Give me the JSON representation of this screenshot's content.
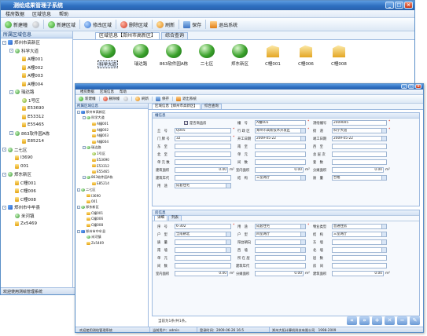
{
  "app": {
    "title": "测绘成果管理子系统"
  },
  "menu": [
    "楼房数据",
    "区域信息",
    "帮助"
  ],
  "toolbar1": [
    {
      "label": "新建幢",
      "icon": "i-green"
    },
    {
      "label": "新建区域",
      "icon": "i-green"
    },
    {
      "label": "修改区域",
      "icon": "i-blue"
    },
    {
      "label": "删除区域",
      "icon": "i-red"
    },
    {
      "label": "刷新",
      "icon": "i-orange"
    },
    {
      "label": "保存",
      "icon": "i-save"
    },
    {
      "label": "退出系统",
      "icon": "i-exit"
    }
  ],
  "toolbar2": [
    {
      "label": "新建幢",
      "icon": "i-green"
    },
    {
      "label": "删除幢",
      "icon": "i-red"
    },
    {
      "label": "刷新",
      "icon": "i-orange"
    },
    {
      "label": "保存",
      "icon": "i-save"
    },
    {
      "label": "退出系统",
      "icon": "i-exit"
    }
  ],
  "left_panel": {
    "title": "所属区域信息"
  },
  "tree": [
    {
      "label": "郑州市高新区",
      "level": 0,
      "icon": "net",
      "exp": "-"
    },
    {
      "label": "科学大道",
      "level": 1,
      "icon": "globe",
      "exp": "-"
    },
    {
      "label": "A幢001",
      "level": 2,
      "icon": "bld"
    },
    {
      "label": "A幢002",
      "level": 2,
      "icon": "bld"
    },
    {
      "label": "A幢003",
      "level": 2,
      "icon": "bld"
    },
    {
      "label": "A幢004",
      "level": 2,
      "icon": "bld"
    },
    {
      "label": "瑞达路",
      "level": 1,
      "icon": "globe",
      "exp": "-"
    },
    {
      "label": "1号区",
      "level": 2,
      "icon": "area"
    },
    {
      "label": "E53690",
      "level": 2,
      "icon": "bld"
    },
    {
      "label": "E53312",
      "level": 2,
      "icon": "bld"
    },
    {
      "label": "E55465",
      "level": 2,
      "icon": "bld"
    },
    {
      "label": "863软件园A栋",
      "level": 1,
      "icon": "globe",
      "exp": "-"
    },
    {
      "label": "E85214",
      "level": 2,
      "icon": "bld"
    },
    {
      "label": "二七区",
      "level": 0,
      "icon": "globe",
      "exp": "-"
    },
    {
      "label": "I3690",
      "level": 1,
      "icon": "bld"
    },
    {
      "label": "001",
      "level": 1,
      "icon": "bld"
    },
    {
      "label": "郑东新区",
      "level": 0,
      "icon": "globe",
      "exp": "-"
    },
    {
      "label": "C幢001",
      "level": 1,
      "icon": "bld"
    },
    {
      "label": "C幢006",
      "level": 1,
      "icon": "bld"
    },
    {
      "label": "C幢008",
      "level": 1,
      "icon": "bld"
    },
    {
      "label": "郑州市中牟县",
      "level": 0,
      "icon": "net",
      "exp": "-"
    },
    {
      "label": "米河镇",
      "level": 1,
      "icon": "globe"
    },
    {
      "label": "Zx5469",
      "level": 1,
      "icon": "bld"
    }
  ],
  "w1": {
    "tabs": [
      "区域信息【郑州市高新区】",
      "综合查询"
    ],
    "grid": [
      {
        "label": "科学大道",
        "icon": "globe",
        "selected": true
      },
      {
        "label": "瑞达路",
        "icon": "globe"
      },
      {
        "label": "863软件园A栋",
        "icon": "globe"
      },
      {
        "label": "二七区",
        "icon": "globe"
      },
      {
        "label": "郑东新区",
        "icon": "globe"
      },
      {
        "label": "C幢001",
        "icon": "bld"
      },
      {
        "label": "C幢006",
        "icon": "bld"
      },
      {
        "label": "C幢008",
        "icon": "bld"
      }
    ],
    "status": "欢迎使用测绘管理系统"
  },
  "w2": {
    "tabs": [
      "区域信息【郑州市高新区】",
      "综合查询"
    ],
    "building_group": "幢信息",
    "house_group": "房信息",
    "house_tabs": [
      "详细",
      "列表"
    ],
    "pager": "当前为1条/共1条。",
    "status": {
      "welcome": "欢迎使用测绘管理系统",
      "user": "当前用户：admin",
      "login": "登录时间：2009-06-26 16:5",
      "copyright": "郑州大阳计算机科技有限公司　1998-2009"
    }
  },
  "bform": {
    "l_best": "是否商品房",
    "v_best": "✓",
    "l_zh": "幢　号",
    "v_zh": "A幢001",
    "l_chzh": "测绘幢号",
    "v_chzh": "2009005",
    "l_qh": "丘　号",
    "v_qh": "Q005",
    "l_xzq": "行 政 区",
    "v_xzq": "郑州市高新技术开发区",
    "l_jd": "街　道",
    "v_jd": "科学大道",
    "l_mph": "门 牌 号",
    "v_mph": "32",
    "l_kg": "开工日期",
    "v_kg": "2009-05-22",
    "l_jg": "竣工日期",
    "v_jg": "2009-05-22",
    "l_dz": "东　至",
    "l_nz": "南　至",
    "l_xz": "西　至",
    "l_bz": "北　至",
    "l_dy": "单　元",
    "l_zcs": "总 层 次",
    "l_dss": "单 元 数",
    "l_js": "间　数",
    "l_ts": "套　数",
    "l_jzmj": "建筑面积",
    "v_jzmj": "0.00",
    "l_snmj": "室内面积",
    "v_snmj": "0.00",
    "l_ftmj": "分摊面积",
    "v_ftmj": "0.00",
    "l_jznd": "建筑年代",
    "l_jiegou": "结　构",
    "v_jiegou": "三室两厅",
    "l_zl": "质　量",
    "v_zl": "合格",
    "l_yt": "用　途",
    "v_yt": "成套住宅",
    "unit": "m²"
  },
  "hform": {
    "l_xh": "序　号",
    "v_xh": "6-302",
    "l_yt": "用　途",
    "v_yt": "成套住宅",
    "l_wy": "物业类型",
    "v_wy": "普通住房",
    "l_hx": "户　型",
    "v_hx": "全南朝北",
    "l_hxjg": "户　型",
    "v_hxjg": "四室两厅",
    "l_jg": "结　构",
    "v_jg": "三室两厅",
    "l_zl": "质　量",
    "l_ytcd": "阳台朝向",
    "l_dq": "东　墙",
    "l_nq": "南　墙",
    "l_xq": "西　墙",
    "l_bq": "北　墙",
    "l_dy": "单　元",
    "l_szc": "所 在 层",
    "l_ceng": "层　数",
    "l_js": "间　数",
    "l_jsnd": "建筑年代",
    "l_fj": "房　间",
    "l_snmj": "室内面积",
    "v_snmj": "0.00",
    "l_ftmj": "分摊面积",
    "v_ftmj": "0.00",
    "l_jzmj": "建筑面积",
    "v_jzmj": "0.00",
    "unit": "m²"
  }
}
